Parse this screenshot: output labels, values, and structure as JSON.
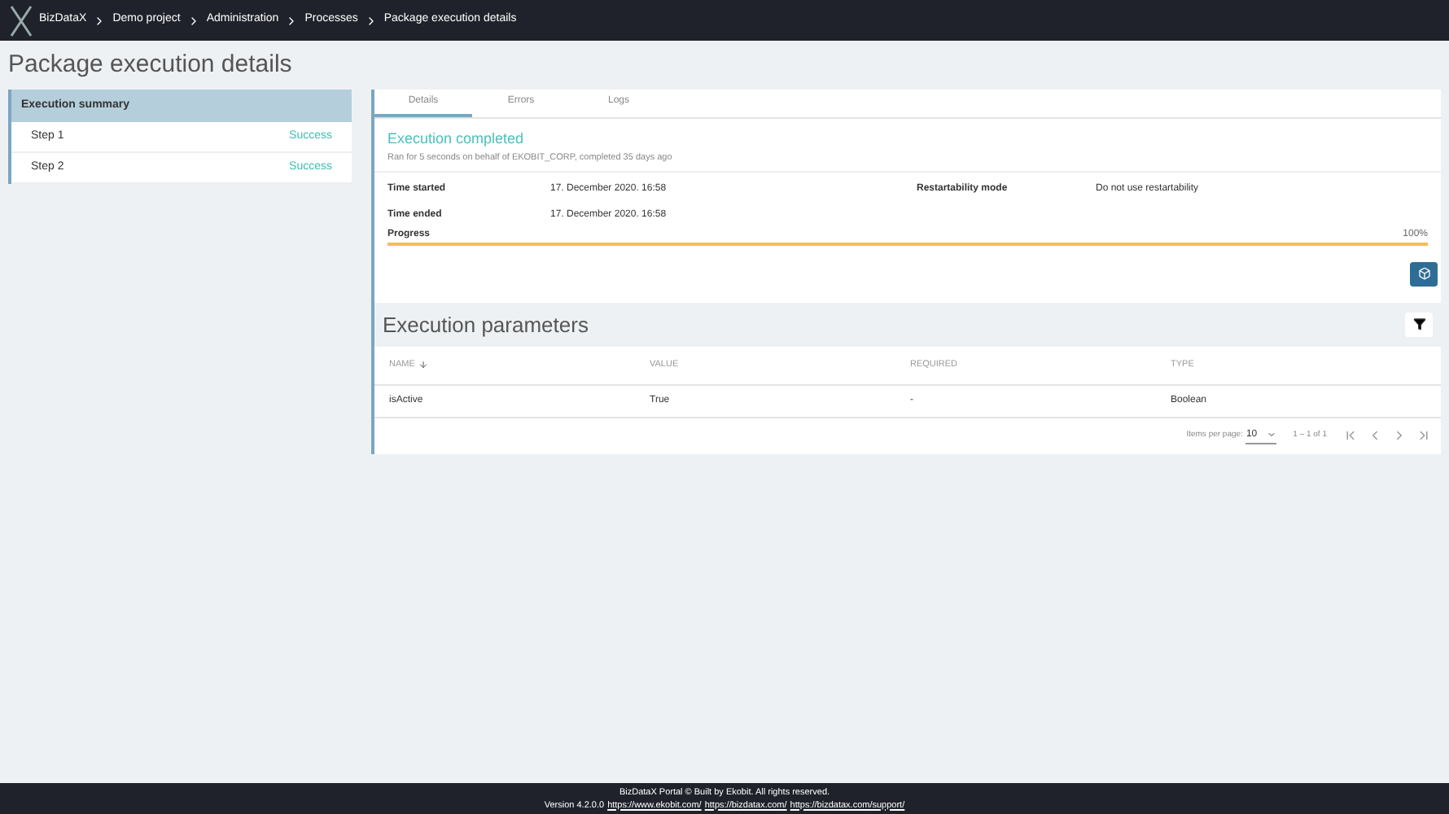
{
  "breadcrumb": [
    "BizDataX",
    "Demo project",
    "Administration",
    "Processes",
    "Package execution details"
  ],
  "page_title": "Package execution details",
  "summary": {
    "title": "Execution summary",
    "steps": [
      {
        "name": "Step 1",
        "status": "Success"
      },
      {
        "name": "Step 2",
        "status": "Success"
      }
    ]
  },
  "tabs": [
    {
      "label": "Details",
      "selected": true
    },
    {
      "label": "Errors",
      "selected": false
    },
    {
      "label": "Logs",
      "selected": false
    }
  ],
  "status": {
    "title": "Execution completed",
    "subtitle": "Ran for 5 seconds on behalf of EKOBIT_CORP, completed 35 days ago"
  },
  "fields": [
    {
      "label": "Time started",
      "value": "17. December 2020. 16:58"
    },
    {
      "label": "Time ended",
      "value": "17. December 2020. 16:58"
    },
    {
      "label": "Restartability mode",
      "value": "Do not use restartability"
    }
  ],
  "progress": {
    "label": "Progress",
    "level": 1,
    "reading": "100%"
  },
  "parameters": {
    "title": "Execution parameters",
    "columns": [
      "NAME",
      "VALUE",
      "REQUIRED",
      "TYPE"
    ],
    "rows": [
      [
        "isActive",
        "True",
        "-",
        "Boolean"
      ]
    ]
  },
  "pagination": {
    "items_per_page_label": "Items per page:",
    "items_per_page": "10",
    "range": "1 – 1 of 1"
  },
  "footer": {
    "line1": "BizDataX Portal © Built by Ekobit. All rights reserved.",
    "version": "Version 4.2.0.0",
    "links": [
      "https://www.ekobit.com/",
      "https://bizdatax.com/",
      "https://bizdatax.com/support/"
    ]
  }
}
